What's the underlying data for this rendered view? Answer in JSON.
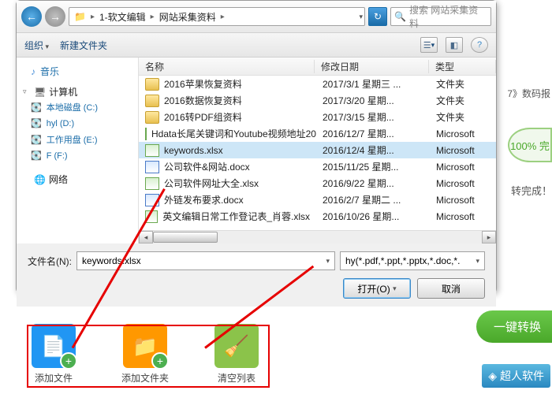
{
  "nav": {
    "back": "←",
    "fwd": "→",
    "refresh": "↻"
  },
  "path": {
    "seg1": "1-软文编辑",
    "seg2": "网站采集资料"
  },
  "search": {
    "placeholder": "搜索 网站采集资料"
  },
  "toolbar": {
    "org": "组织",
    "newf": "新建文件夹"
  },
  "sidebar": {
    "music": "音乐",
    "computer": "计算机",
    "drives": [
      "本地磁盘 (C:)",
      "hyl (D:)",
      "工作用盘 (E:)",
      "F (F:)"
    ],
    "network": "网络"
  },
  "columns": {
    "name": "名称",
    "date": "修改日期",
    "type": "类型"
  },
  "files": [
    {
      "ic": "folder",
      "n": "2016苹果恢复资料",
      "d": "2017/3/1 星期三 ...",
      "t": "文件夹"
    },
    {
      "ic": "folder",
      "n": "2016数据恢复资料",
      "d": "2017/3/20 星期...",
      "t": "文件夹"
    },
    {
      "ic": "folder",
      "n": "2016转PDF组资料",
      "d": "2017/3/15 星期...",
      "t": "文件夹"
    },
    {
      "ic": "xlsx",
      "n": "Hdata长尾关键词和Youtube视频地址20...",
      "d": "2016/12/7 星期...",
      "t": "Microsoft"
    },
    {
      "ic": "xlsx",
      "n": "keywords.xlsx",
      "d": "2016/12/4 星期...",
      "t": "Microsoft",
      "sel": true
    },
    {
      "ic": "docx",
      "n": "公司软件&网站.docx",
      "d": "2015/11/25 星期...",
      "t": "Microsoft"
    },
    {
      "ic": "xlsx",
      "n": "公司软件网址大全.xlsx",
      "d": "2016/9/22 星期...",
      "t": "Microsoft"
    },
    {
      "ic": "docx",
      "n": "外链发布要求.docx",
      "d": "2016/2/7 星期二 ...",
      "t": "Microsoft"
    },
    {
      "ic": "xlsx",
      "n": "英文编辑日常工作登记表_肖蓉.xlsx",
      "d": "2016/10/26 星期...",
      "t": "Microsoft"
    }
  ],
  "footer": {
    "label": "文件名(N):",
    "value": "keywords.xlsx",
    "filter": "hy(*.pdf,*.ppt,*.pptx,*.doc,*.",
    "open": "打开(O)",
    "cancel": "取消"
  },
  "bottom": {
    "addFile": "添加文件",
    "addFolder": "添加文件夹",
    "clear": "清空列表"
  },
  "side": {
    "convert": "一键转换",
    "soft": "超人软件",
    "pct": "100%  完",
    "done": "转完成！",
    "digital": "7》数码报",
    "brand": "超人软件"
  }
}
